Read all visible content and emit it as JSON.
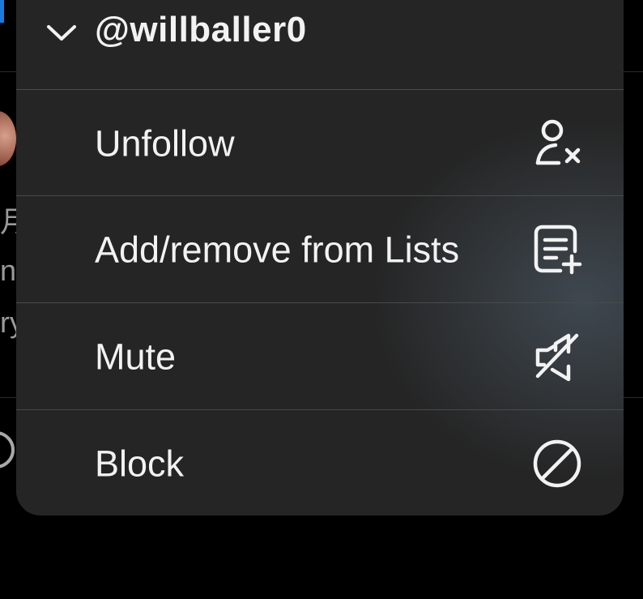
{
  "background": {
    "visible_fragments": [
      "月",
      "n",
      "ry"
    ]
  },
  "menu": {
    "header": {
      "title": "@willballer0",
      "icon": "chevron-down-icon"
    },
    "items": [
      {
        "label": "Unfollow",
        "icon": "unfollow-user-icon"
      },
      {
        "label": "Add/remove from Lists",
        "icon": "list-add-icon"
      },
      {
        "label": "Mute",
        "icon": "mute-speaker-icon"
      },
      {
        "label": "Block",
        "icon": "block-icon"
      }
    ]
  },
  "colors": {
    "menu_background": "#252525",
    "separator": "#4a4a4a",
    "text": "#f2f2f2",
    "page_background": "#000000"
  }
}
